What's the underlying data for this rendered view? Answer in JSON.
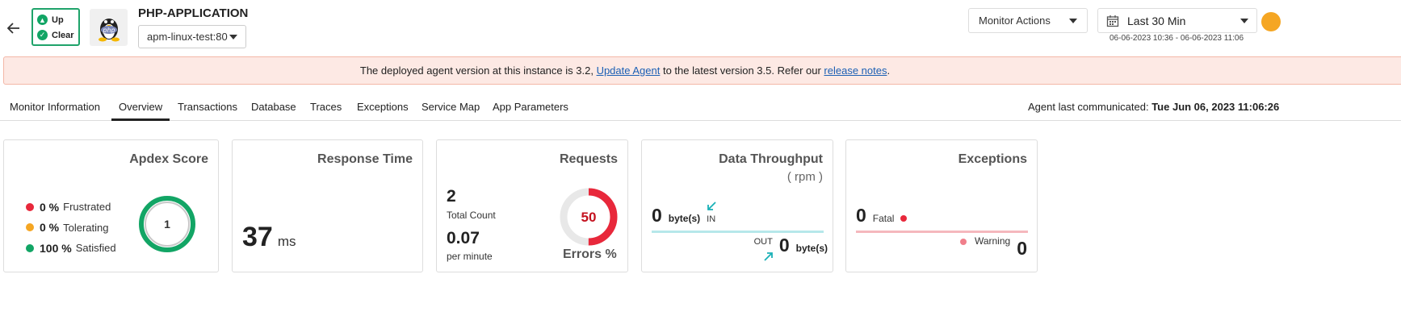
{
  "header": {
    "status": {
      "up": "Up",
      "clear": "Clear"
    },
    "app_title": "PHP-APPLICATION",
    "instance": "apm-linux-test:80",
    "monitor_actions": "Monitor Actions",
    "time_period": "Last 30 Min",
    "time_range": "06-06-2023 10:36 - 06-06-2023 11:06"
  },
  "banner": {
    "prefix": "The deployed agent version at this instance is 3.2, ",
    "update_link": "Update Agent",
    "middle": " to the latest version 3.5. Refer our ",
    "notes_link": "release notes",
    "suffix": "."
  },
  "tabs": [
    "Monitor Information",
    "Overview",
    "Transactions",
    "Database",
    "Traces",
    "Exceptions",
    "Service Map",
    "App Parameters"
  ],
  "active_tab": "Overview",
  "agent_comm": {
    "label": "Agent last communicated: ",
    "value": "Tue Jun 06, 2023 11:06:26"
  },
  "apdex": {
    "title": "Apdex Score",
    "score": "1",
    "legend": [
      {
        "value": "0 %",
        "label": "Frustrated",
        "color": "#e8283b"
      },
      {
        "value": "0 %",
        "label": "Tolerating",
        "color": "#f5a623"
      },
      {
        "value": "100 %",
        "label": "Satisfied",
        "color": "#12a565"
      }
    ]
  },
  "response_time": {
    "title": "Response Time",
    "value": "37",
    "unit": "ms"
  },
  "requests": {
    "title": "Requests",
    "total_count": "2",
    "total_label": "Total Count",
    "rate": "0.07",
    "rate_label": "per minute",
    "errors_value": "50",
    "errors_fraction": 0.5,
    "errors_label": "Errors %"
  },
  "throughput": {
    "title": "Data Throughput",
    "subtitle": "( rpm )",
    "in_value": "0",
    "in_unit": "byte(s)",
    "in_label": "IN",
    "out_value": "0",
    "out_unit": "byte(s)",
    "out_label": "OUT"
  },
  "exceptions": {
    "title": "Exceptions",
    "fatal_value": "0",
    "fatal_label": "Fatal",
    "warning_value": "0",
    "warning_label": "Warning"
  },
  "colors": {
    "up_green": "#12a565",
    "error_red": "#e8283b",
    "warn_orange": "#f5a623",
    "in_teal": "#1ab1b7"
  }
}
